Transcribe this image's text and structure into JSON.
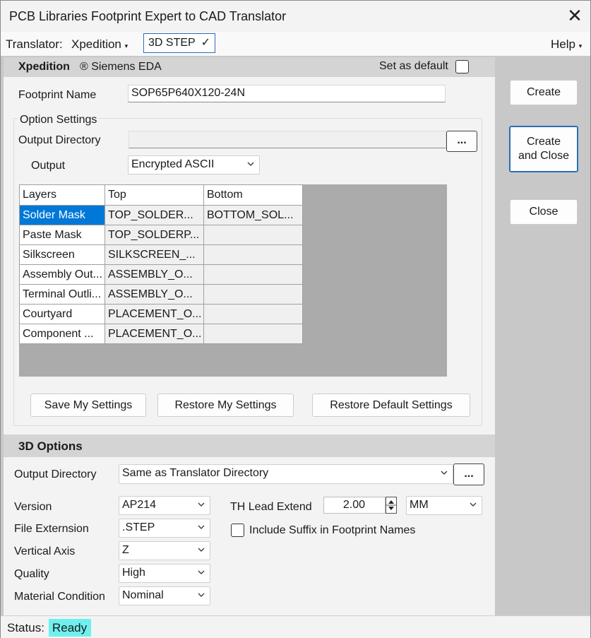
{
  "window": {
    "title": "PCB Libraries Footprint Expert to CAD Translator",
    "close_glyph": "✕"
  },
  "menubar": {
    "translator_label": "Translator:",
    "translator_value": "Xpedition",
    "step_label": "3D STEP",
    "step_check": "✓",
    "help_label": "Help",
    "caret": "▾"
  },
  "header": {
    "cad_name": "Xpedition",
    "vendor": "® Siemens EDA",
    "set_default_label": "Set as default"
  },
  "footprint": {
    "label": "Footprint Name",
    "value": "SOP65P640X120-24N"
  },
  "options": {
    "group_label": "Option Settings",
    "output_dir_label": "Output Directory",
    "output_dir_value": "",
    "browse_label": "...",
    "output_label": "Output",
    "output_value": "Encrypted ASCII"
  },
  "layers_table": {
    "headers": [
      "Layers",
      "Top",
      "Bottom"
    ],
    "rows": [
      [
        "Solder Mask",
        "TOP_SOLDER...",
        "BOTTOM_SOL..."
      ],
      [
        "Paste Mask",
        "TOP_SOLDERP...",
        ""
      ],
      [
        "Silkscreen",
        "SILKSCREEN_...",
        ""
      ],
      [
        "Assembly Out...",
        "ASSEMBLY_O...",
        ""
      ],
      [
        "Terminal Outli...",
        "ASSEMBLY_O...",
        ""
      ],
      [
        "Courtyard",
        "PLACEMENT_O...",
        ""
      ],
      [
        "Component ...",
        "PLACEMENT_O...",
        ""
      ]
    ]
  },
  "settings_buttons": {
    "save": "Save My Settings",
    "restore": "Restore My Settings",
    "restore_default": "Restore Default Settings"
  },
  "side_buttons": {
    "create": "Create",
    "create_close_line1": "Create",
    "create_close_line2": "and Close",
    "close": "Close"
  },
  "options3d": {
    "header": "3D Options",
    "output_dir_label": "Output Directory",
    "output_dir_value": "Same as Translator Directory",
    "browse_label": "...",
    "version_label": "Version",
    "version_value": "AP214",
    "ext_label": "File Externsion",
    "ext_value": ".STEP",
    "axis_label": "Vertical Axis",
    "axis_value": "Z",
    "quality_label": "Quality",
    "quality_value": "High",
    "material_label": "Material Condition",
    "material_value": "Nominal",
    "th_label": "TH Lead Extend",
    "th_value": "2.00",
    "units_value": "MM",
    "suffix_label": "Include Suffix in Footprint Names"
  },
  "status": {
    "label": "Status:",
    "value": "Ready",
    "value_color": "#6ff0ef"
  },
  "colors": {
    "selection": "#0078d7",
    "accent_border": "#2a6fb5"
  }
}
